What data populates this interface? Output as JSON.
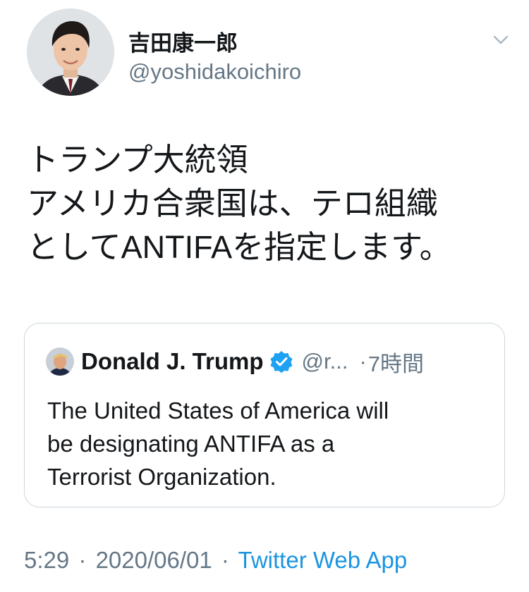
{
  "author": {
    "display_name": "吉田康一郎",
    "handle": "@yoshidakoichiro"
  },
  "tweet": {
    "lines": [
      "トランプ大統領",
      "アメリカ合衆国は、テロ組織",
      "としてANTIFAを指定します。"
    ]
  },
  "quoted_tweet": {
    "display_name": "Donald J. Trump",
    "handle": "@r...",
    "separator": "·",
    "time": "7時間",
    "lines": [
      "The United States of America will",
      "be designating ANTIFA as a",
      "Terrorist Organization."
    ]
  },
  "meta": {
    "time": "5:29",
    "separator1": "·",
    "date": "2020/06/01",
    "separator2": "·",
    "source": "Twitter Web App"
  },
  "icons": {
    "menu": "chevron-down-icon",
    "verified": "verified-badge-icon"
  },
  "colors": {
    "text": "#14171a",
    "secondary": "#657786",
    "link": "#1b95e0",
    "border": "#ccd6dd",
    "verified": "#1da1f2"
  }
}
